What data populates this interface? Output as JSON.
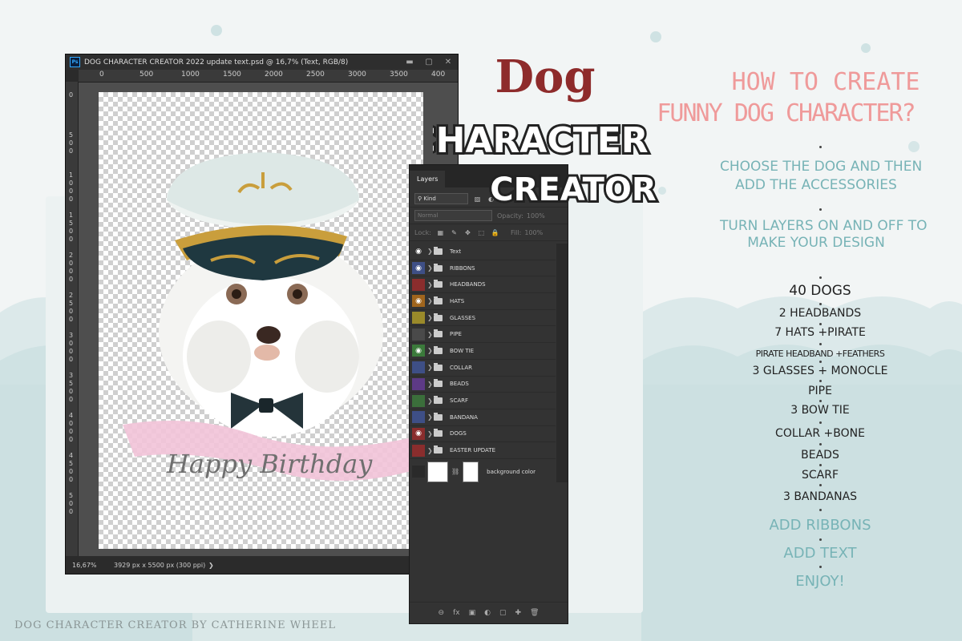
{
  "colors": {
    "pink": "#ef9a9a",
    "teal": "#77b3b6",
    "title_red": "#8e2b2b",
    "ps_blue": "#31a8ff"
  },
  "window": {
    "logo": "Ps",
    "title": "DOG CHARACTER CREATOR 2022 update text.psd @ 16,7% (Text, RGB/8)",
    "minimize_icon": "▬",
    "restore_icon": "▢",
    "close_icon": "✕"
  },
  "ruler": {
    "h": [
      "0",
      "500",
      "1000",
      "1500",
      "2000",
      "2500",
      "3000",
      "3500",
      "400"
    ],
    "v": [
      "0",
      "500",
      "1000",
      "1500",
      "2000",
      "2500",
      "3000",
      "3500",
      "4000",
      "4500",
      "500"
    ]
  },
  "canvas_art": {
    "ribbon_text": "Happy Birthday"
  },
  "status": {
    "zoom": "16,67%",
    "size": "3929 px x 5500 px (300 ppi)",
    "arrow": "❯"
  },
  "layers_panel": {
    "tab": "Layers",
    "kind": "Kind",
    "blend_mode": "Normal",
    "opacity_label": "Opacity:",
    "opacity_value": "100%",
    "lock_label": "Lock:",
    "fill_label": "Fill:",
    "fill_value": "100%",
    "layers": [
      {
        "name": "Text",
        "color": "#333333",
        "visible": true
      },
      {
        "name": "RIBBONS",
        "color": "#3e4f86",
        "visible": true
      },
      {
        "name": "HEADBANDS",
        "color": "#8a2d2d",
        "visible": false
      },
      {
        "name": "HATS",
        "color": "#a0651d",
        "visible": true
      },
      {
        "name": "GLASSES",
        "color": "#9a8a2a",
        "visible": false
      },
      {
        "name": "PIPE",
        "color": "#4a4a4a",
        "visible": false
      },
      {
        "name": "BOW TIE",
        "color": "#3b7a3b",
        "visible": true
      },
      {
        "name": "COLLAR",
        "color": "#3e4f86",
        "visible": false
      },
      {
        "name": "BEADS",
        "color": "#5d3a86",
        "visible": false
      },
      {
        "name": "SCARF",
        "color": "#3b6e3b",
        "visible": false
      },
      {
        "name": "BANDANA",
        "color": "#3e4f86",
        "visible": false
      },
      {
        "name": "DOGS",
        "color": "#8a2d2d",
        "visible": true
      },
      {
        "name": "EASTER UPDATE",
        "color": "#8a2d2d",
        "visible": false
      }
    ],
    "background_layer": "background color",
    "bottom_icons": [
      "⊖",
      "fx",
      "▣",
      "◐",
      "▢",
      "✚",
      "🗑"
    ]
  },
  "logo_text": {
    "line1": "Dog",
    "line2": "CHARACTER",
    "line3": "CREATOR"
  },
  "right": {
    "heading1": "HOW TO CREATE",
    "heading2": "FUNNY DOG CHARACTER?",
    "step1_line1": "CHOOSE THE DOG AND THEN",
    "step1_line2": "ADD THE ACCESSORIES",
    "step2_line1": "TURN LAYERS ON AND OFF TO",
    "step2_line2": "MAKE YOUR DESIGN",
    "list": [
      "40 DOGS",
      "2 HEADBANDS",
      "7 HATS +PIRATE",
      "PIRATE HEADBAND +FEATHERS",
      "3 GLASSES + MONOCLE",
      "PIPE",
      "3 BOW TIE",
      "COLLAR +BONE",
      "BEADS",
      "SCARF",
      "3 BANDANAS"
    ],
    "extras": [
      "ADD RIBBONS",
      "ADD TEXT",
      "ENJOY!"
    ]
  },
  "footer": "DOG CHARACTER CREATOR BY CATHERINE WHEEL"
}
